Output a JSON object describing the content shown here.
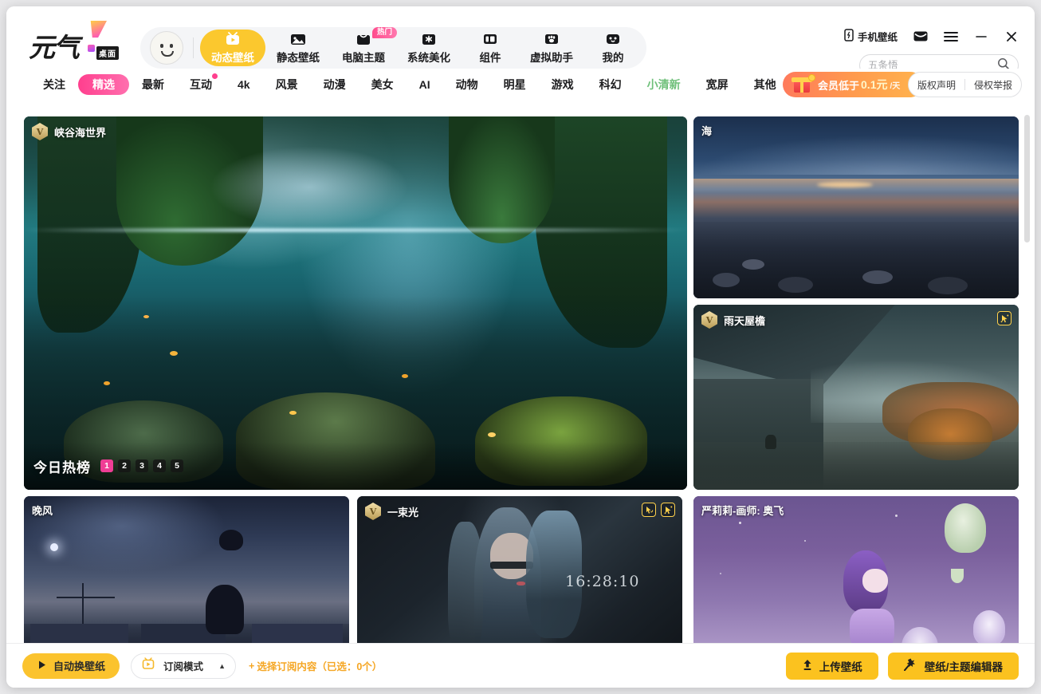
{
  "app": {
    "logo_text": "元气",
    "logo_sub": "桌面"
  },
  "header": {
    "nav": [
      {
        "label": "动态壁纸",
        "icon": "tv-play-icon",
        "active": true,
        "badge": ""
      },
      {
        "label": "静态壁纸",
        "icon": "image-icon",
        "active": false,
        "badge": ""
      },
      {
        "label": "电脑主题",
        "icon": "shirt-icon",
        "active": false,
        "badge": "热门"
      },
      {
        "label": "系统美化",
        "icon": "sparkle-icon",
        "active": false,
        "badge": ""
      },
      {
        "label": "组件",
        "icon": "widget-icon",
        "active": false,
        "badge": ""
      },
      {
        "label": "虚拟助手",
        "icon": "paw-icon",
        "active": false,
        "badge": ""
      },
      {
        "label": "我的",
        "icon": "robot-icon",
        "active": false,
        "badge": ""
      }
    ],
    "phone_wallpaper": "手机壁纸",
    "window_buttons": [
      "mail-icon",
      "menu-icon",
      "minimize-icon",
      "close-icon"
    ]
  },
  "search": {
    "value": "",
    "placeholder": "五条悟",
    "icon": "search-icon"
  },
  "categories": [
    {
      "label": "关注",
      "state": "normal"
    },
    {
      "label": "精选",
      "state": "active"
    },
    {
      "label": "最新",
      "state": "normal"
    },
    {
      "label": "互动",
      "state": "dot"
    },
    {
      "label": "4k",
      "state": "normal"
    },
    {
      "label": "风景",
      "state": "normal"
    },
    {
      "label": "动漫",
      "state": "normal"
    },
    {
      "label": "美女",
      "state": "normal"
    },
    {
      "label": "AI",
      "state": "normal"
    },
    {
      "label": "动物",
      "state": "normal"
    },
    {
      "label": "明星",
      "state": "normal"
    },
    {
      "label": "游戏",
      "state": "normal"
    },
    {
      "label": "科幻",
      "state": "normal"
    },
    {
      "label": "小清新",
      "state": "fresh"
    },
    {
      "label": "宽屏",
      "state": "normal"
    },
    {
      "label": "其他",
      "state": "normal"
    }
  ],
  "vip_banner": {
    "prefix": "会员低于",
    "amount": "0.1元",
    "suffix": "/天"
  },
  "legal": {
    "copyright": "版权声明",
    "report": "侵权举报"
  },
  "hero": {
    "title": "峡谷海世界",
    "vip": true,
    "hot_label": "今日热榜",
    "pages": [
      "1",
      "2",
      "3",
      "4",
      "5"
    ],
    "active_page": "1"
  },
  "cards": [
    {
      "title": "海",
      "vip": false,
      "icons": []
    },
    {
      "title": "雨天屋檐",
      "vip": true,
      "icons": [
        "cursor-interactive-icon"
      ]
    },
    {
      "title": "晚风",
      "vip": false,
      "icons": []
    },
    {
      "title": "一束光",
      "vip": true,
      "icons": [
        "mouse-trail-icon",
        "cursor-interactive-icon"
      ],
      "clock": "16:28:10"
    },
    {
      "title": "严莉莉-画师: 奥飞",
      "vip": false,
      "icons": []
    }
  ],
  "bottom": {
    "auto_change": "自动换壁纸",
    "sub_mode": "订阅模式",
    "sub_pick": "选择订阅内容（已选：0个）",
    "sub_pick_plus": "+",
    "upload": "上传壁纸",
    "editor": "壁纸/主题编辑器"
  },
  "colors": {
    "accent_yellow": "#fbc21f",
    "accent_pink": "#ff3f8e",
    "vip_orange": "#ff9a4d"
  }
}
